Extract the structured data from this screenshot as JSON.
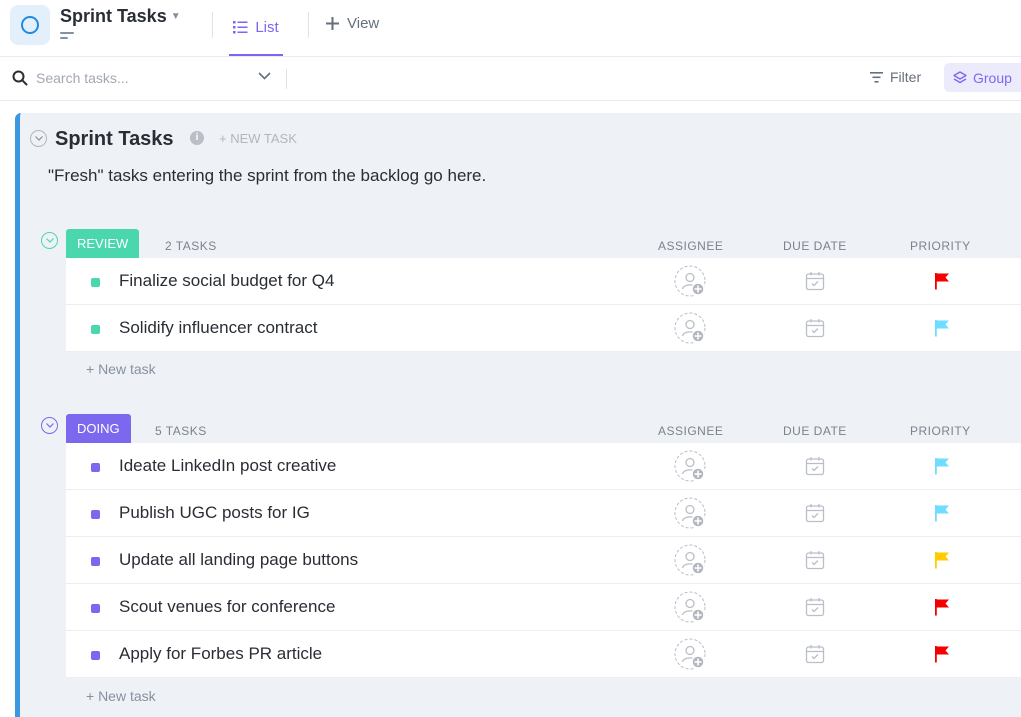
{
  "header": {
    "title": "Sprint Tasks",
    "tab_list": "List",
    "tab_view": "View"
  },
  "toolbar": {
    "search_placeholder": "Search tasks...",
    "filter_label": "Filter",
    "group_label": "Group"
  },
  "list": {
    "title": "Sprint Tasks",
    "new_task_label": "+ NEW TASK",
    "description": "\"Fresh\" tasks entering the sprint from the backlog go here."
  },
  "columns": {
    "assignee": "ASSIGNEE",
    "due_date": "DUE DATE",
    "priority": "PRIORITY"
  },
  "groups": [
    {
      "status": "REVIEW",
      "color": "#4ad7ae",
      "count": "2 TASKS",
      "new_task": "+ New task",
      "tasks": [
        {
          "name": "Finalize social budget for Q4",
          "priority": "urgent"
        },
        {
          "name": "Solidify influencer contract",
          "priority": "normal"
        }
      ]
    },
    {
      "status": "DOING",
      "color": "#7b68ee",
      "count": "5 TASKS",
      "new_task": "+ New task",
      "tasks": [
        {
          "name": "Ideate LinkedIn post creative",
          "priority": "normal"
        },
        {
          "name": "Publish UGC posts for IG",
          "priority": "normal"
        },
        {
          "name": "Update all landing page buttons",
          "priority": "high"
        },
        {
          "name": "Scout venues for conference",
          "priority": "urgent"
        },
        {
          "name": "Apply for Forbes PR article",
          "priority": "urgent"
        }
      ]
    }
  ],
  "priority_colors": {
    "urgent": "#f50000",
    "high": "#ffcc00",
    "normal": "#6fddff"
  },
  "accent_color": "#7b68ee",
  "list_border_color": "#3a98e0"
}
